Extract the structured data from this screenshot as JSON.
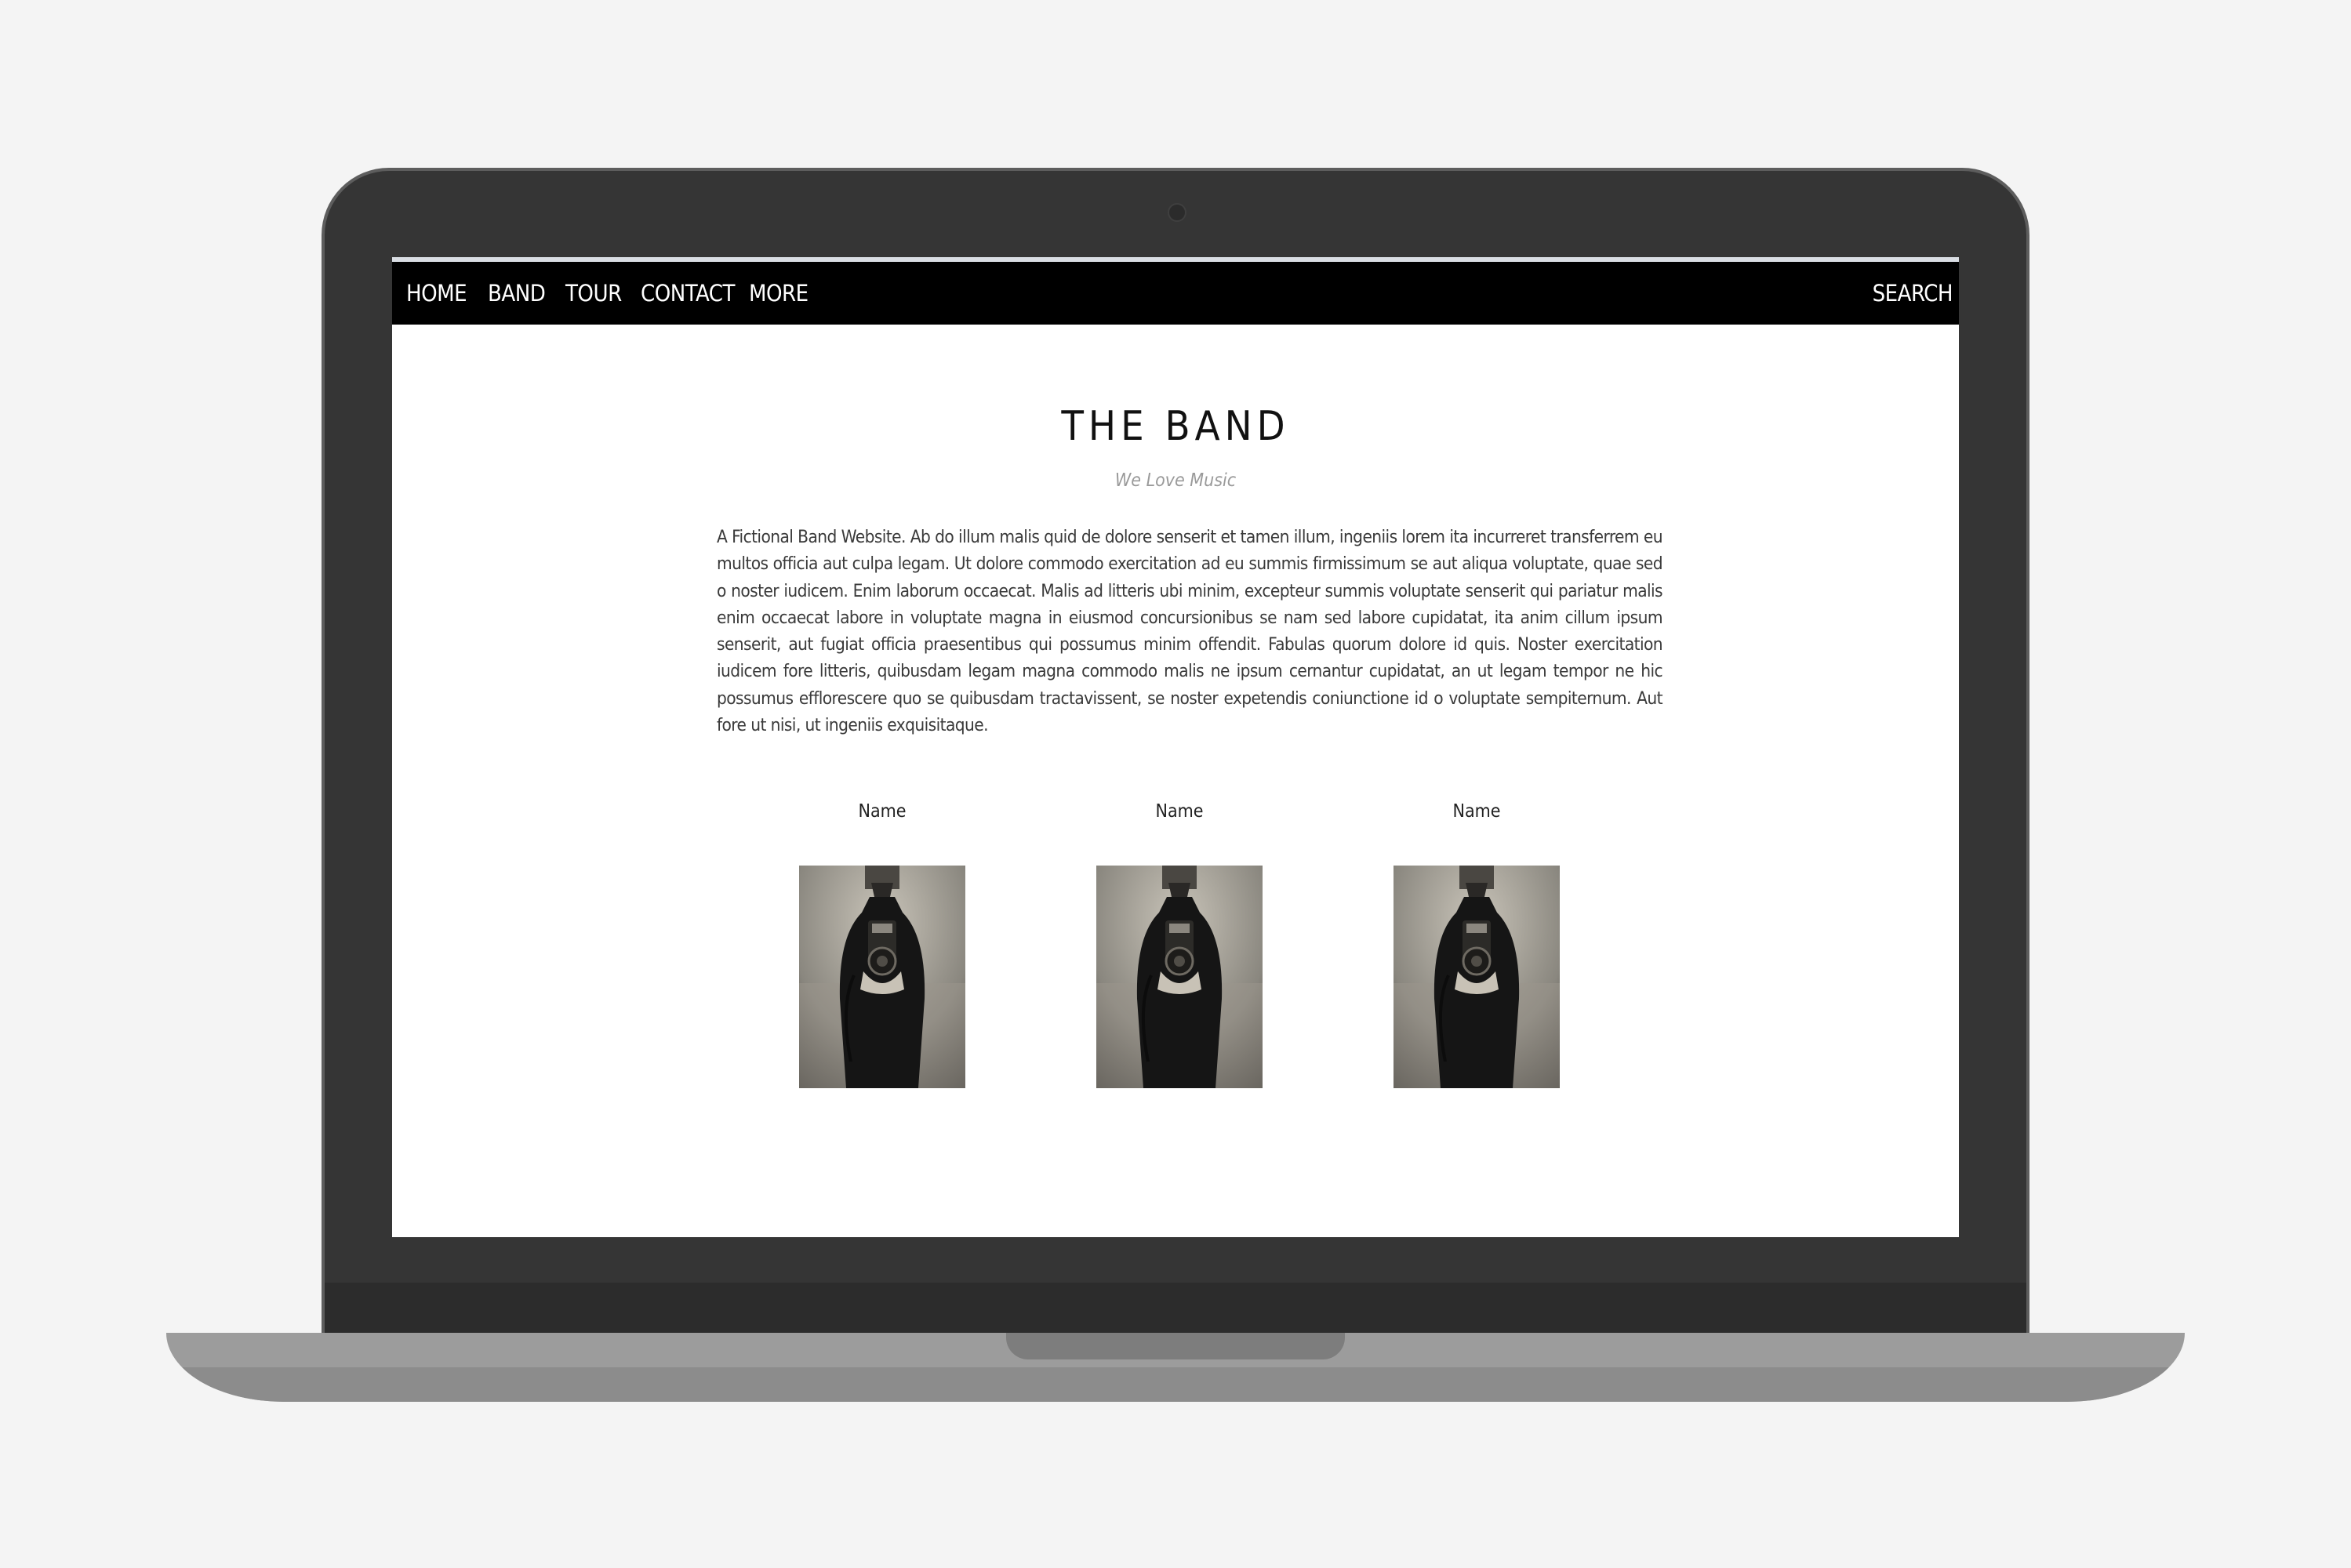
{
  "nav": {
    "items": [
      {
        "label": "HOME"
      },
      {
        "label": "BAND"
      },
      {
        "label": "TOUR"
      },
      {
        "label": "CONTACT"
      },
      {
        "label": "MORE"
      }
    ],
    "search_label": "SEARCH"
  },
  "band": {
    "title": "THE BAND",
    "tagline": "We Love Music",
    "description": "A Fictional Band Website. Ab do illum malis quid de dolore senserit et tamen illum, ingeniis lorem ita incurreret transferrem eu multos officia aut culpa legam. Ut dolore commodo exercitation ad eu summis firmissimum se aut aliqua voluptate, quae sed o noster iudicem. Enim laborum occaecat. Malis ad litteris ubi minim, excepteur summis voluptate senserit qui pariatur malis enim occaecat labore in voluptate magna in eiusmod concursionibus se nam sed labore cupidatat, ita anim cillum ipsum senserit, aut fugiat officia praesentibus qui possumus minim offendit. Fabulas quorum dolore id quis. Noster exercitation iudicem fore litteris, quibusdam legam magna commodo malis ne ipsum cernantur cupidatat, an ut legam tempor ne hic possumus efflorescere quo se quibusdam tractavissent, se noster expetendis coniunctione id o voluptate sempiternum. Aut fore ut nisi, ut ingeniis exquisitaque."
  },
  "members": [
    {
      "name": "Name",
      "photo_icon": "person-holding-camera-photo"
    },
    {
      "name": "Name",
      "photo_icon": "person-holding-camera-photo"
    },
    {
      "name": "Name",
      "photo_icon": "person-holding-camera-photo"
    }
  ],
  "colors": {
    "navbar_bg": "#000000",
    "nav_text": "#ffffff",
    "tagline": "#9a9a9a",
    "laptop_bezel": "#353535",
    "laptop_base": "#9c9c9c"
  }
}
